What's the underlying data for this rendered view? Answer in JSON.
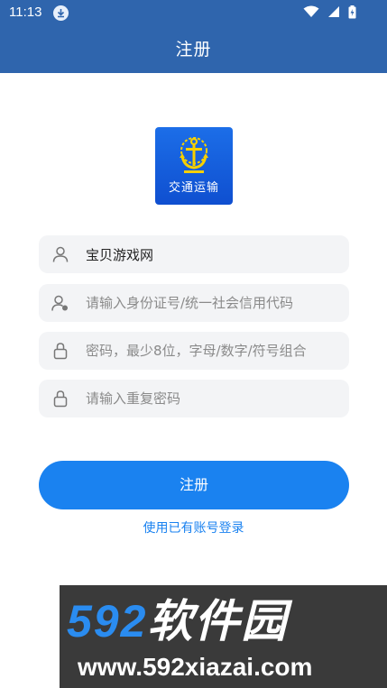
{
  "status_bar": {
    "time": "11:13"
  },
  "header": {
    "title": "注册"
  },
  "logo": {
    "text": "交通运输"
  },
  "form": {
    "username": {
      "value": "宝贝游戏网",
      "icon": "user-icon"
    },
    "id_number": {
      "placeholder": "请输入身份证号/统一社会信用代码",
      "icon": "id-card-icon"
    },
    "password": {
      "placeholder": "密码，最少8位，字母/数字/符号组合",
      "icon": "lock-icon"
    },
    "confirm_password": {
      "placeholder": "请输入重复密码",
      "icon": "lock-icon"
    }
  },
  "actions": {
    "register_label": "注册",
    "login_link": "使用已有账号登录"
  },
  "watermark": {
    "brand_number": "592",
    "brand_text": "软件园",
    "url": "www.592xiazai.com"
  },
  "colors": {
    "appbar": "#2f65ad",
    "primary_button": "#1a82f0",
    "field_background": "#f3f4f6"
  }
}
